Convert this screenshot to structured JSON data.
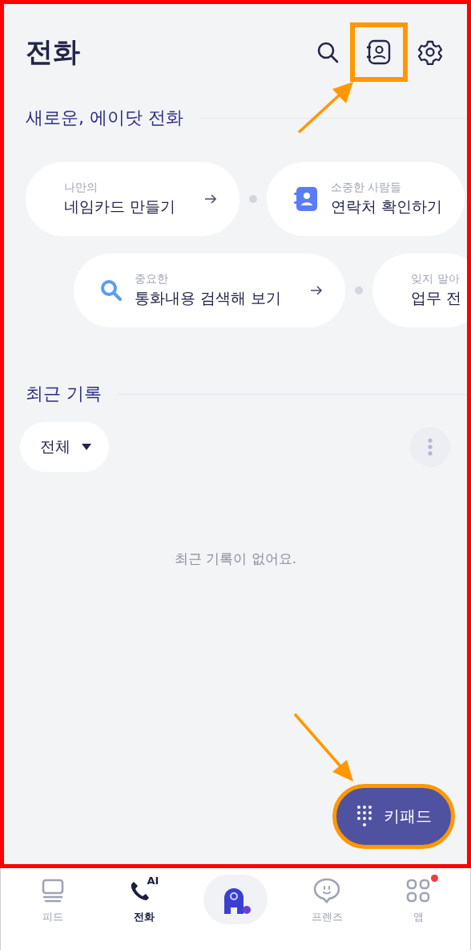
{
  "header": {
    "title": "전화",
    "actions": [
      {
        "kind": "search",
        "highlighted": false
      },
      {
        "kind": "contacts",
        "highlighted": true
      },
      {
        "kind": "settings",
        "highlighted": false
      }
    ]
  },
  "promo": {
    "title": "새로운, 에이닷 전화",
    "rows": [
      [
        {
          "kind": "plain",
          "subtitle": "나만의",
          "title": "네임카드 만들기",
          "arrow": true
        },
        {
          "kind": "contacts",
          "subtitle": "소중한 사람들",
          "title": "연락처 확인하기",
          "arrow": false
        }
      ],
      [
        {
          "kind": "search",
          "subtitle": "중요한",
          "title": "통화내용 검색해 보기",
          "arrow": true
        },
        {
          "kind": "plain",
          "subtitle": "잊지 말아",
          "title": "업무 전",
          "arrow": false
        }
      ]
    ]
  },
  "recent": {
    "title": "최근 기록",
    "filter": {
      "label": "전체"
    },
    "empty_message": "최근 기록이 없어요."
  },
  "fab": {
    "label": "키패드",
    "highlighted": true
  },
  "nav": [
    {
      "kind": "feed",
      "label": "피드",
      "selected": false,
      "dot": false
    },
    {
      "kind": "call",
      "label": "전화",
      "icon_text": "AI",
      "selected": true,
      "dot": false
    },
    {
      "kind": "assistant",
      "selected": false,
      "dot": false
    },
    {
      "kind": "friends",
      "label": "프렌즈",
      "selected": false,
      "dot": false
    },
    {
      "kind": "apps",
      "label": "앱",
      "selected": false,
      "dot": true
    }
  ]
}
